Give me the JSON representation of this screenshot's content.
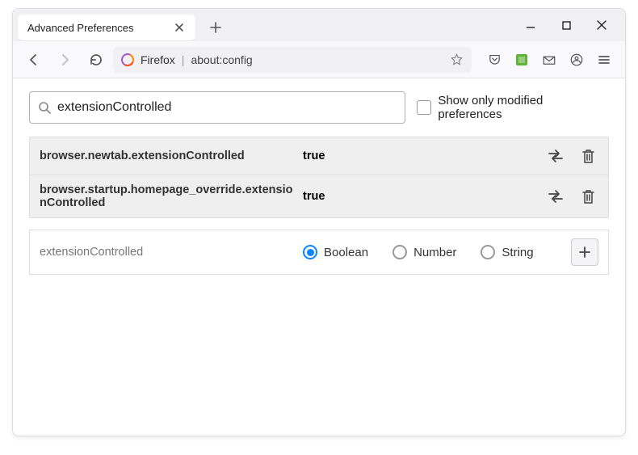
{
  "tab": {
    "title": "Advanced Preferences"
  },
  "urlbar": {
    "prefix": "Firefox",
    "url": "about:config"
  },
  "search": {
    "value": "extensionControlled"
  },
  "modified_label": "Show only modified preferences",
  "prefs": [
    {
      "name": "browser.newtab.extensionControlled",
      "value": "true"
    },
    {
      "name": "browser.startup.homepage_override.extensionControlled",
      "value": "true"
    }
  ],
  "new_pref": {
    "name": "extensionControlled",
    "types": [
      "Boolean",
      "Number",
      "String"
    ],
    "selected": "Boolean"
  }
}
